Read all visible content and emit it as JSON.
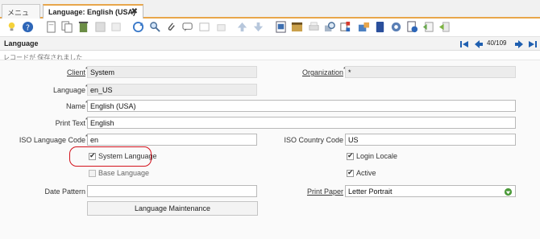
{
  "tabs": [
    {
      "label": "メニュー"
    },
    {
      "label": "Language: English (USA)",
      "close": "✖"
    }
  ],
  "toolbar_icons": [
    "lightbulb-icon",
    "help-icon",
    "new-record-icon",
    "copy-record-icon",
    "delete-icon",
    "save-icon",
    "undo-icon",
    "refresh-icon",
    "find-icon",
    "attachment-icon",
    "chat-icon",
    "notes-icon",
    "up-icon",
    "down-icon",
    "report-icon",
    "archive-icon",
    "print-icon",
    "zoom-across-icon",
    "request-icon",
    "product-info-icon",
    "workflow-icon",
    "settings-icon",
    "process-icon",
    "export-icon",
    "exit-icon"
  ],
  "window": {
    "title": "Language",
    "counter": "40/109"
  },
  "status": "レコードが 保存されました",
  "form": {
    "client_label": "Client",
    "client_value": "System",
    "organization_label": "Organization",
    "organization_value": "*",
    "language_label": "Language",
    "language_value": "en_US",
    "name_label": "Name",
    "name_value": "English (USA)",
    "print_text_label": "Print Text",
    "print_text_value": "English",
    "iso_language_label": "ISO Language Code",
    "iso_language_value": "en",
    "iso_country_label": "ISO Country Code",
    "iso_country_value": "US",
    "system_language_label": "System Language",
    "login_locale_label": "Login Locale",
    "base_language_label": "Base Language",
    "active_label": "Active",
    "date_pattern_label": "Date Pattern",
    "date_pattern_value": "",
    "print_paper_label": "Print Paper",
    "print_paper_value": "Letter Portrait",
    "maintenance_button": "Language Maintenance",
    "req_mark": "*"
  },
  "colors": {
    "accent": "#e8a64b",
    "highlight": "#d3121c"
  }
}
